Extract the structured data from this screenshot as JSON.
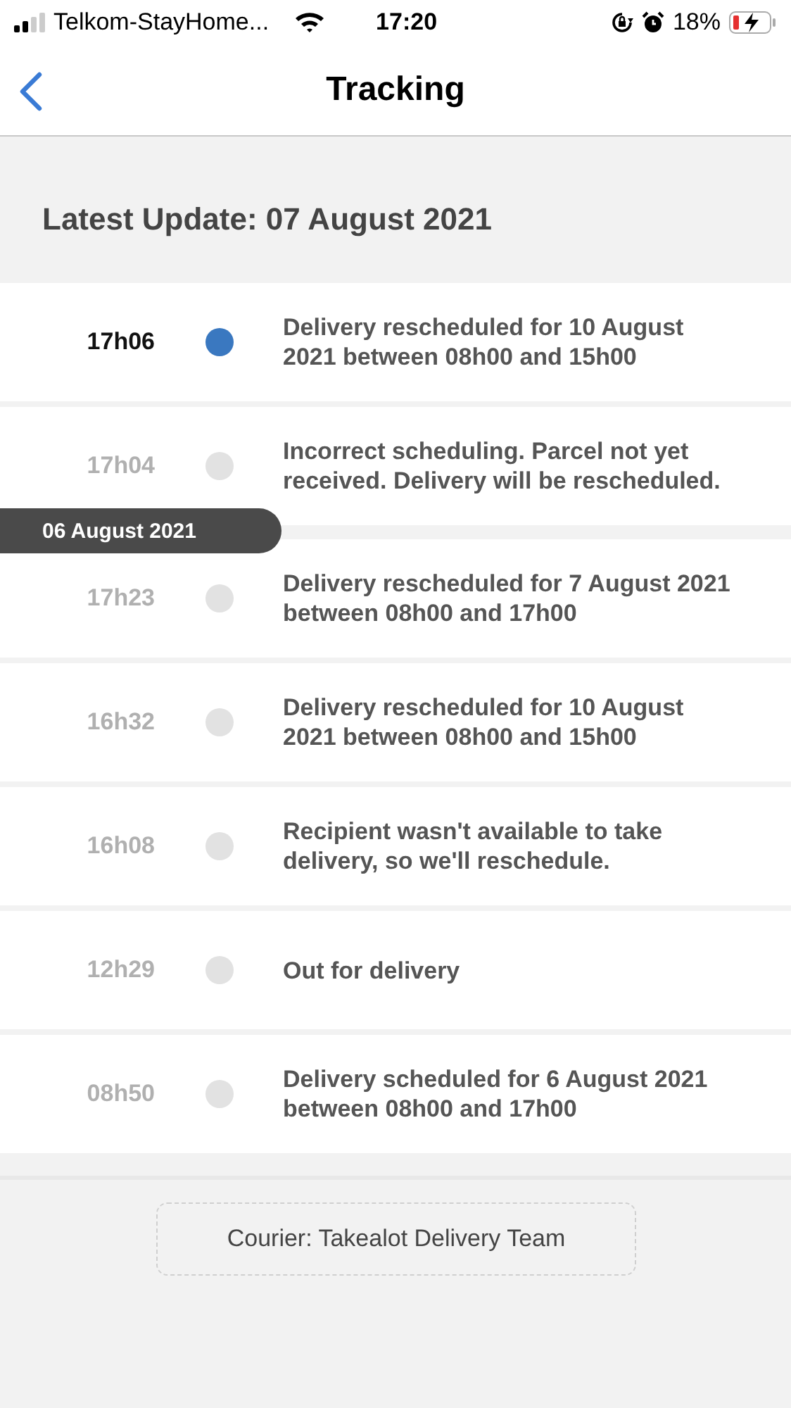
{
  "status_bar": {
    "carrier": "Telkom-StayHome...",
    "time": "17:20",
    "battery": "18%"
  },
  "nav": {
    "title": "Tracking"
  },
  "latest_update": "Latest Update: 07 August 2021",
  "timeline": [
    {
      "kind": "event",
      "time": "17h06",
      "text": "Delivery rescheduled for 10 August 2021 between 08h00 and 15h00",
      "selected": true
    },
    {
      "kind": "event",
      "time": "17h04",
      "text": "Incorrect scheduling. Parcel not yet received. Delivery will be rescheduled.",
      "selected": false
    },
    {
      "kind": "date",
      "text": "06 August 2021"
    },
    {
      "kind": "event",
      "time": "17h23",
      "text": "Delivery rescheduled for 7 August 2021 between 08h00 and 17h00",
      "selected": false
    },
    {
      "kind": "event",
      "time": "16h32",
      "text": "Delivery rescheduled for 10 August 2021 between 08h00 and 15h00",
      "selected": false
    },
    {
      "kind": "event",
      "time": "16h08",
      "text": "Recipient wasn't available to take delivery, so we'll reschedule.",
      "selected": false
    },
    {
      "kind": "event",
      "time": "12h29",
      "text": "Out for delivery",
      "selected": false
    },
    {
      "kind": "event",
      "time": "08h50",
      "text": "Delivery scheduled for 6 August 2021 between 08h00 and 17h00",
      "selected": false
    }
  ],
  "courier": "Courier: Takealot Delivery Team"
}
